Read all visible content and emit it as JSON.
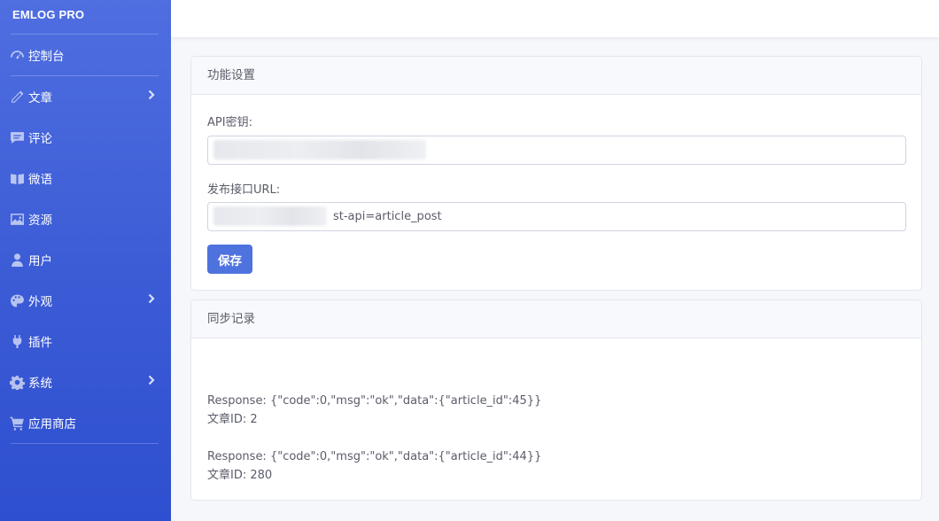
{
  "brand": "EMLOG PRO",
  "nav": [
    {
      "label": "控制台",
      "icon": "dashboard-icon",
      "has_children": false
    },
    {
      "label": "文章",
      "icon": "pencil-icon",
      "has_children": true
    },
    {
      "label": "评论",
      "icon": "comment-icon",
      "has_children": false
    },
    {
      "label": "微语",
      "icon": "note-icon",
      "has_children": false
    },
    {
      "label": "资源",
      "icon": "image-icon",
      "has_children": false
    },
    {
      "label": "用户",
      "icon": "user-icon",
      "has_children": false
    },
    {
      "label": "外观",
      "icon": "palette-icon",
      "has_children": true
    },
    {
      "label": "插件",
      "icon": "plug-icon",
      "has_children": false
    },
    {
      "label": "系统",
      "icon": "gear-icon",
      "has_children": true
    },
    {
      "label": "应用商店",
      "icon": "cart-icon",
      "has_children": false
    }
  ],
  "settings": {
    "title": "功能设置",
    "api_key_label": "API密钥:",
    "api_key_value": "",
    "url_label": "发布接口URL:",
    "url_value_visible": "st-api=article_post",
    "save_label": "保存"
  },
  "sync": {
    "title": "同步记录",
    "records": [
      {
        "response": "Response: {\"code\":0,\"msg\":\"ok\",\"data\":{\"article_id\":45}}",
        "article": "文章ID: 2"
      },
      {
        "response": "Response: {\"code\":0,\"msg\":\"ok\",\"data\":{\"article_id\":44}}",
        "article": "文章ID: 280"
      }
    ]
  },
  "colors": {
    "sidebar": "#3b5bd6",
    "primary_button": "#4e73df"
  }
}
